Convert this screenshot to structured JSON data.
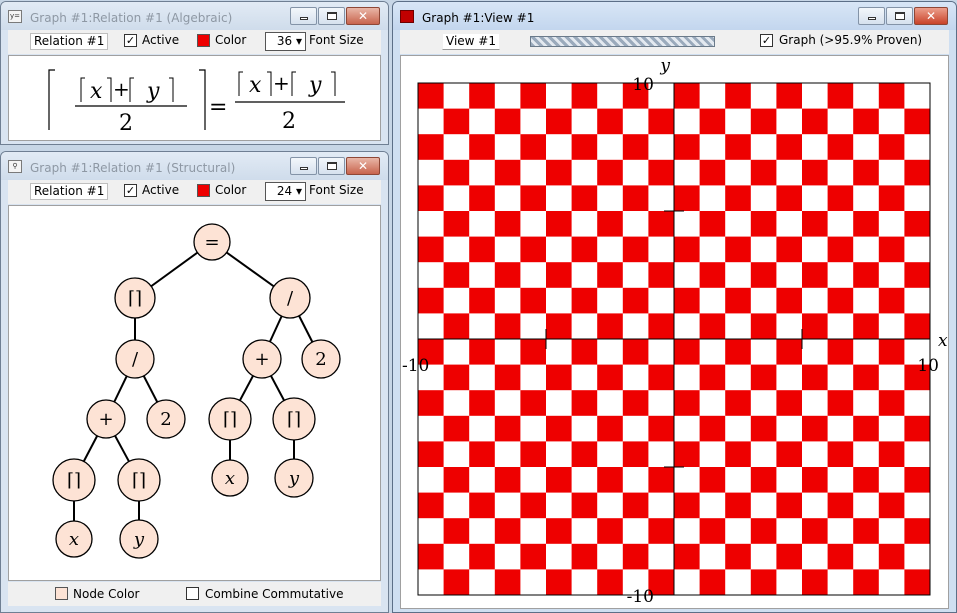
{
  "algebraic_window": {
    "title": "Graph #1:Relation #1 (Algebraic)",
    "icon": "y=",
    "toolbar": {
      "relation_field": "Relation #1",
      "active_label": "Active",
      "active_checked": "✓",
      "color_label": "Color",
      "color": "#ee0000",
      "font_size_value": "36",
      "font_size_label": "Font Size"
    },
    "formula": {
      "lhs_x": "x",
      "lhs_y": "y",
      "plus": "+",
      "equals": "=",
      "denominator": "2",
      "rhs_x": "x",
      "rhs_y": "y"
    }
  },
  "structural_window": {
    "title": "Graph #1:Relation #1 (Structural)",
    "toolbar": {
      "relation_field": "Relation #1",
      "active_label": "Active",
      "active_checked": "✓",
      "color_label": "Color",
      "color": "#ee0000",
      "font_size_value": "24",
      "font_size_label": "Font Size"
    },
    "tree": {
      "root": "=",
      "ceil": "⌈⌉",
      "divide": "/",
      "plus": "+",
      "two": "2",
      "x": "x",
      "y": "y"
    },
    "node_color": "#fde3d5",
    "bottom": {
      "node_color_label": "Node Color",
      "combine_label": "Combine Commutative"
    }
  },
  "view_window": {
    "title": "Graph #1:View #1",
    "toolbar": {
      "view_field": "View #1",
      "graph_checked": "✓",
      "graph_label": "Graph (>95.9% Proven)"
    },
    "axes": {
      "x_label": "x",
      "y_label": "y",
      "x_min": "-10",
      "x_max": "10",
      "y_min": "-10",
      "y_max": "10"
    },
    "fill_color": "#ee0000",
    "grid_cells": 20
  }
}
